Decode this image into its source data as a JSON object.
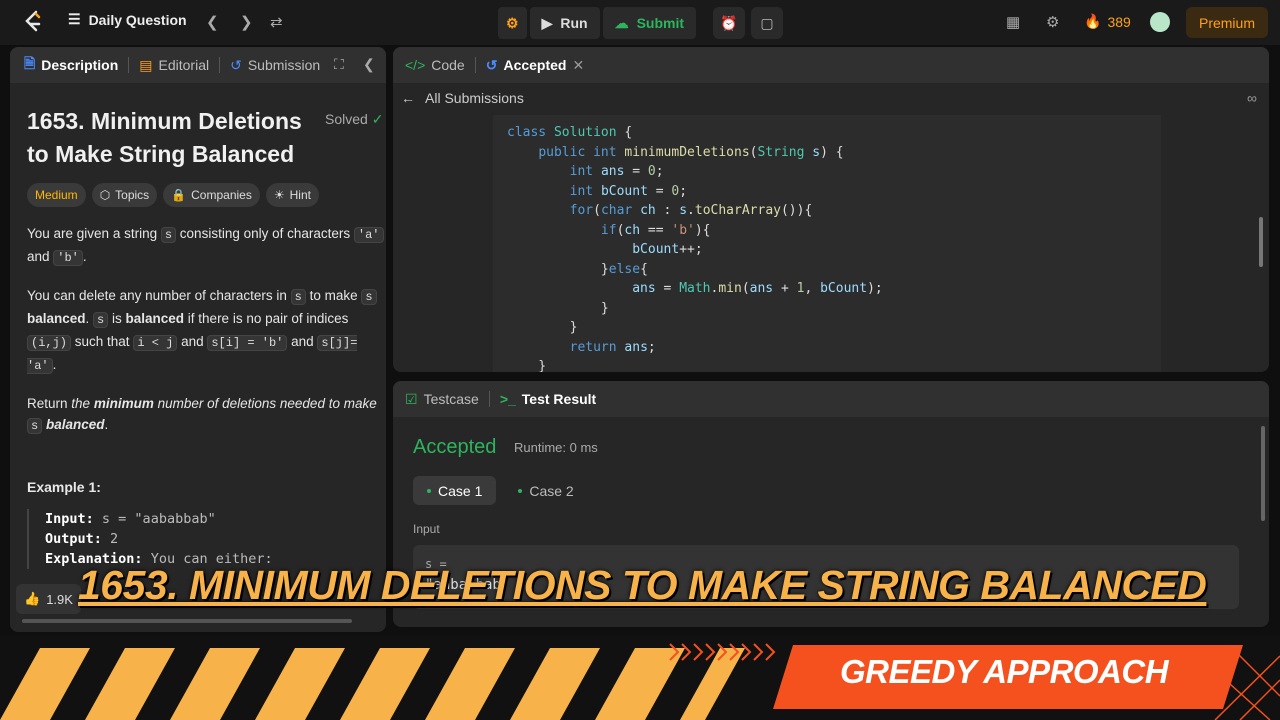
{
  "topbar": {
    "daily_question": "Daily Question",
    "run_label": "Run",
    "submit_label": "Submit",
    "streak_count": "389",
    "premium_label": "Premium"
  },
  "left_panel": {
    "tabs": [
      "Description",
      "Editorial",
      "Submission"
    ],
    "title": "1653. Minimum Deletions to Make String Balanced",
    "solved_label": "Solved",
    "tags": [
      "Medium",
      "Topics",
      "Companies",
      "Hint"
    ],
    "example_heading": "Example 1:",
    "example": {
      "input_label": "Input:",
      "input_value": "s = \"aababbab\"",
      "output_label": "Output:",
      "output_value": "2",
      "explanation_label": "Explanation:",
      "explanation_value": "You can either:"
    },
    "likes": "1.9K"
  },
  "code_panel": {
    "tab_code": "Code",
    "tab_accepted": "Accepted",
    "all_submissions": "All Submissions"
  },
  "result_panel": {
    "tab_testcase": "Testcase",
    "tab_result": "Test Result",
    "status": "Accepted",
    "runtime": "Runtime: 0 ms",
    "cases": [
      "Case 1",
      "Case 2"
    ],
    "input_label": "Input",
    "input_var": "s =",
    "input_value": "\"aababbab\""
  },
  "overlay": {
    "title": "1653. MINIMUM DELETIONS TO MAKE STRING BALANCED",
    "approach": "GREEDY APPROACH"
  },
  "colors": {
    "accent_orange": "#ffa116",
    "accepted_green": "#2db55d",
    "banner_orange": "#f4511e",
    "stripe_yellow": "#f7b24a"
  }
}
